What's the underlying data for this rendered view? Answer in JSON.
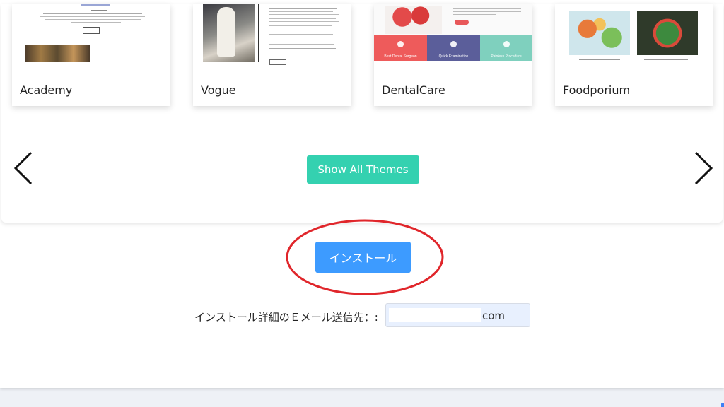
{
  "themes": [
    {
      "name": "Academy"
    },
    {
      "name": "Vogue"
    },
    {
      "name": "DentalCare"
    },
    {
      "name": "Foodporium"
    }
  ],
  "dental_thumb": {
    "features": [
      "Best Dental Surgeon",
      "Quick Examination",
      "Painless Procedure"
    ]
  },
  "carousel": {
    "prev_icon": "chevron-left-icon",
    "next_icon": "chevron-right-icon",
    "show_all_label": "Show All Themes"
  },
  "install": {
    "button_label": "インストール",
    "email_label": "インストール詳細のＥメール送信先：:",
    "email_suffix": "com"
  },
  "colors": {
    "show_all_bg": "#34d1b0",
    "install_bg": "#3d9bff",
    "highlight": "#e0262b",
    "email_field_bg": "#e8f0fe"
  }
}
